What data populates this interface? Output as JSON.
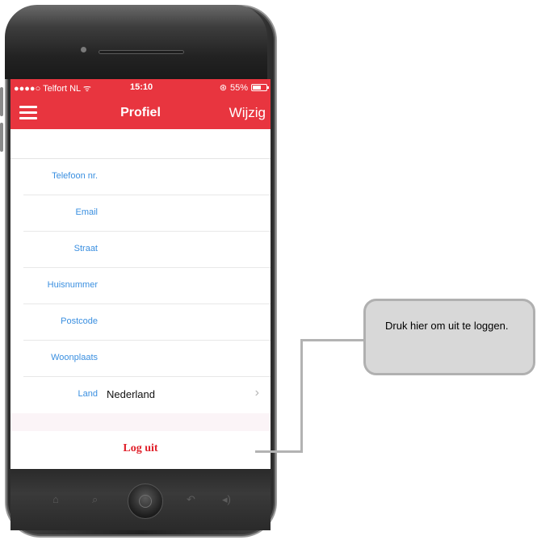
{
  "status_bar": {
    "carrier": "●●●●○ Telfort NL",
    "time": "15:10",
    "battery": "55%"
  },
  "nav": {
    "title": "Profiel",
    "edit_label": "Wijzig"
  },
  "fields": [
    {
      "label": "Telefoon nr.",
      "value": ""
    },
    {
      "label": "Email",
      "value": ""
    },
    {
      "label": "Straat",
      "value": ""
    },
    {
      "label": "Huisnummer",
      "value": ""
    },
    {
      "label": "Postcode",
      "value": ""
    },
    {
      "label": "Woonplaats",
      "value": ""
    },
    {
      "label": "Land",
      "value": "Nederland"
    }
  ],
  "logout_label": "Log uit",
  "callout": {
    "text": "Druk hier om uit te loggen."
  },
  "colors": {
    "accent": "#e8353f",
    "label_blue": "#3a8fe0",
    "logout_red": "#e0212b"
  },
  "icons": {
    "menu": "menu-icon",
    "wifi": "wifi-icon",
    "battery": "battery-icon",
    "chevron": "chevron-right-icon",
    "home": "home-icon",
    "search": "search-icon",
    "back": "back-icon",
    "volume": "volume-icon"
  }
}
